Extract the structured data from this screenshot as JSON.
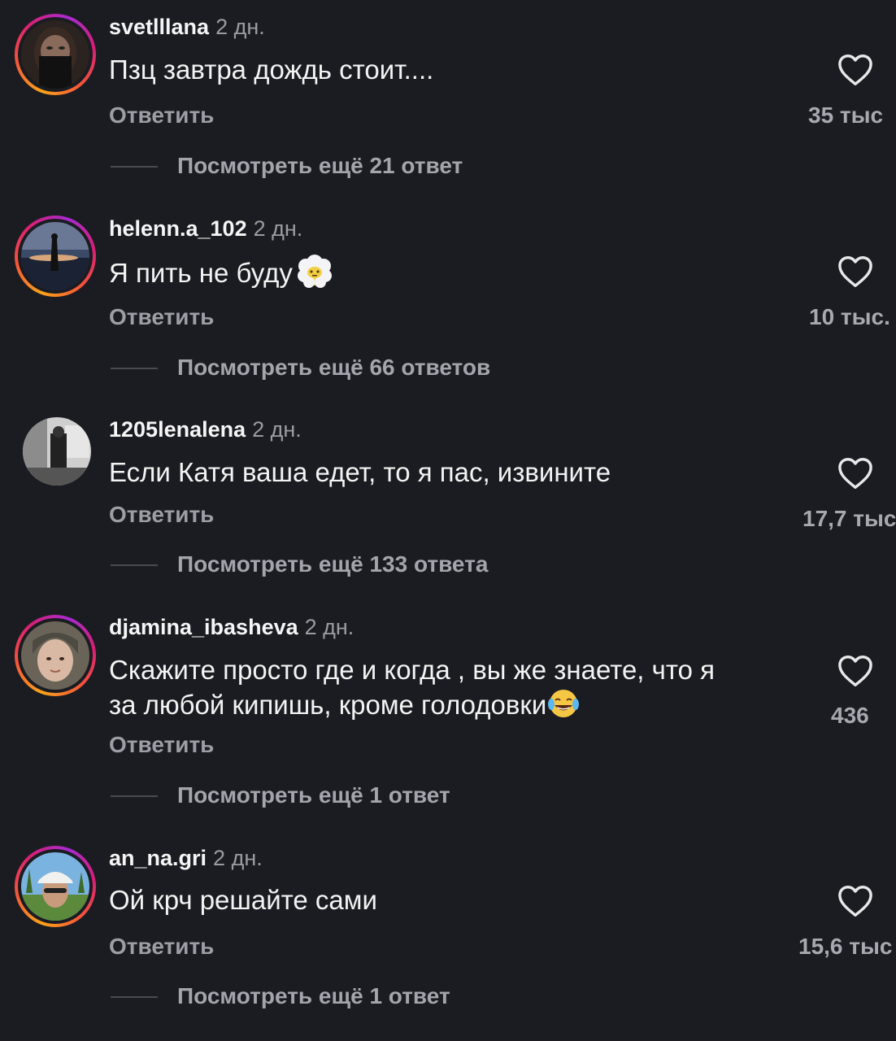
{
  "colors": {
    "background": "#1b1c21",
    "text": "#f3f3f3",
    "secondary": "#9c9ea5",
    "story_ring": [
      "#f9a21b",
      "#f5553a",
      "#d81f75"
    ]
  },
  "comments": [
    {
      "username": "svetlllana",
      "time": "2 дн.",
      "text": "Пзц завтра дождь стоит....",
      "reply_label": "Ответить",
      "likes": "35 тыс",
      "view_replies": "Посмотреть ещё 21 ответ",
      "has_story_ring": true
    },
    {
      "username": "helenn.a_102",
      "time": "2 дн.",
      "text": "Я пить не буду",
      "emoji": "face-in-clouds-emoji",
      "reply_label": "Ответить",
      "likes": "10 тыс.",
      "view_replies": "Посмотреть ещё 66 ответов",
      "has_story_ring": true
    },
    {
      "username": "1205lenalena",
      "time": "2 дн.",
      "text": "Если Катя ваша едет, то я пас, извините",
      "reply_label": "Ответить",
      "likes": "17,7 тыс",
      "view_replies": "Посмотреть ещё 133 ответа",
      "has_story_ring": false
    },
    {
      "username": "djamina_ibasheva",
      "time": "2 дн.",
      "text_line1": "Скажите просто где и когда , вы же знаете, что я",
      "text_line2": "за любой кипишь, кроме голодовки",
      "emoji": "tears-of-joy-emoji",
      "reply_label": "Ответить",
      "likes": "436",
      "view_replies": "Посмотреть ещё 1 ответ",
      "has_story_ring": true
    },
    {
      "username": "an_na.gri",
      "time": "2 дн.",
      "text": "Ой крч решайте сами",
      "reply_label": "Ответить",
      "likes": "15,6 тыс",
      "view_replies": "Посмотреть ещё 1 ответ",
      "has_story_ring": true
    }
  ]
}
